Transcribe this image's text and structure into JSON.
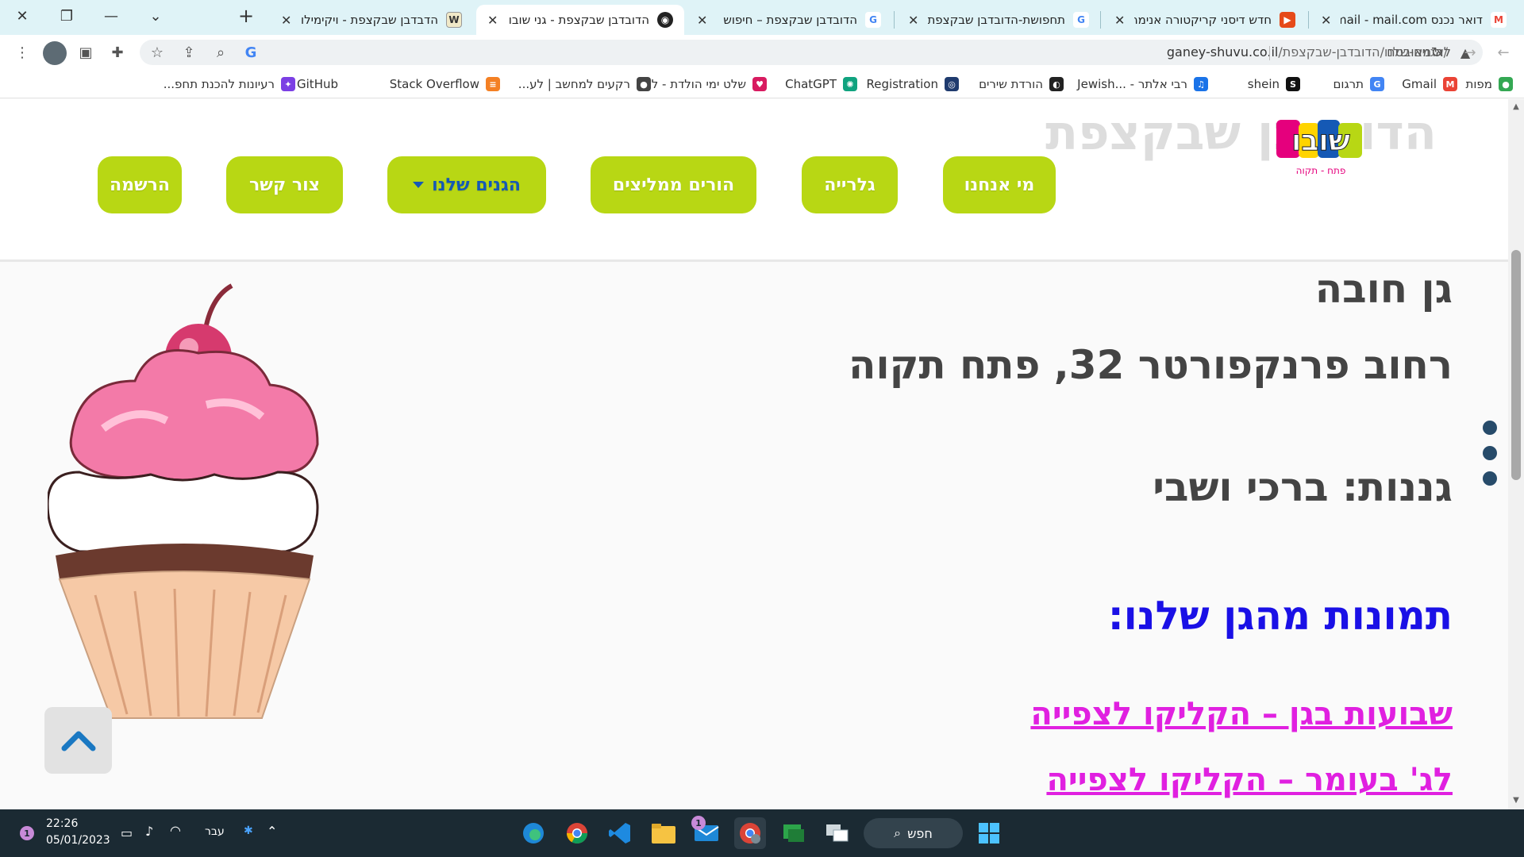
{
  "browser": {
    "tabs": [
      {
        "title": "דואר נכנס Gmail - mail.com",
        "favicon": "gmail-icon",
        "active": false
      },
      {
        "title": "חדש דיסני קריקטורה אנימה",
        "favicon": "video-icon",
        "active": false
      },
      {
        "title": "תחפושת-הדובדבן שבקצפת",
        "favicon": "google-icon",
        "active": false
      },
      {
        "title": "הדובדבן שבקצפת – חיפוש",
        "favicon": "google-icon",
        "active": false
      },
      {
        "title": "הדובדבן שבקצפת - גני שובו",
        "favicon": "globe-icon",
        "active": true
      },
      {
        "title": "הדבדבן שבקצפת - ויקימילון",
        "favicon": "wiktionary-icon",
        "active": false
      }
    ],
    "security_label": "לא מאובטח",
    "url_domain": "ganey-shuvu.co.il",
    "url_path": "/הגנים-שלנו/הדובדבן-שבקצפת/",
    "bookmarks": [
      {
        "label": "מפות",
        "icon": "maps-icon",
        "color": "#34a853"
      },
      {
        "label": "Gmail",
        "icon": "gmail-icon",
        "color": "#ea4335"
      },
      {
        "label": "תרגום",
        "icon": "translate-icon",
        "color": "#4285f4"
      },
      {
        "label": "shein",
        "icon": "shein-icon",
        "color": "#111111"
      },
      {
        "label": "רבי אלתר - ...Jewish",
        "icon": "headphones-icon",
        "color": "#1a73e8"
      },
      {
        "label": "הורדת שירים",
        "icon": "music-icon",
        "color": "#222222"
      },
      {
        "label": "Registration",
        "icon": "fingerprint-icon",
        "color": "#1f3b6e"
      },
      {
        "label": "ChatGPT",
        "icon": "chatgpt-icon",
        "color": "#10a37f"
      },
      {
        "label": "שלט ימי הולדת - לו...",
        "icon": "cake-icon",
        "color": "#d81b60"
      },
      {
        "label": "רקעים למחשב | לע...",
        "icon": "image-icon",
        "color": "#444444"
      },
      {
        "label": "Stack Overflow",
        "icon": "stackoverflow-icon",
        "color": "#f48024"
      },
      {
        "label": "GitHub",
        "icon": "github-icon",
        "color": "#24292e"
      },
      {
        "label": "רעיונות להכנת תחפ...",
        "icon": "ideas-icon",
        "color": "#7b3fe4"
      }
    ]
  },
  "site": {
    "ghost_title": "הדובדבן שבקצפת",
    "logo_text": "שובו",
    "logo_sub": "פתח - תקוה",
    "nav": [
      {
        "label": "מי אנחנו"
      },
      {
        "label": "גלרייה"
      },
      {
        "label": "הורים ממליצים"
      },
      {
        "label": "הגנים שלנו",
        "dropdown": true
      },
      {
        "label": "צור קשר"
      },
      {
        "label": "הרשמה"
      }
    ],
    "heading_type": "גן חובה",
    "address": "רחוב פרנקפורטר 32, פתח תקוה",
    "teachers": "גננות: ברכי ושבי",
    "photos_heading": "תמונות מהגן שלנו:",
    "link_shavuot": "שבועות בגן – הקליקו לצפייה",
    "link_second": "לג' בעומר – הקליקו לצפייה"
  },
  "taskbar": {
    "time": "22:26",
    "date": "05/01/2023",
    "language": "עבר",
    "search_label": "חפש",
    "notification_count": "1",
    "mail_badge": "1"
  }
}
